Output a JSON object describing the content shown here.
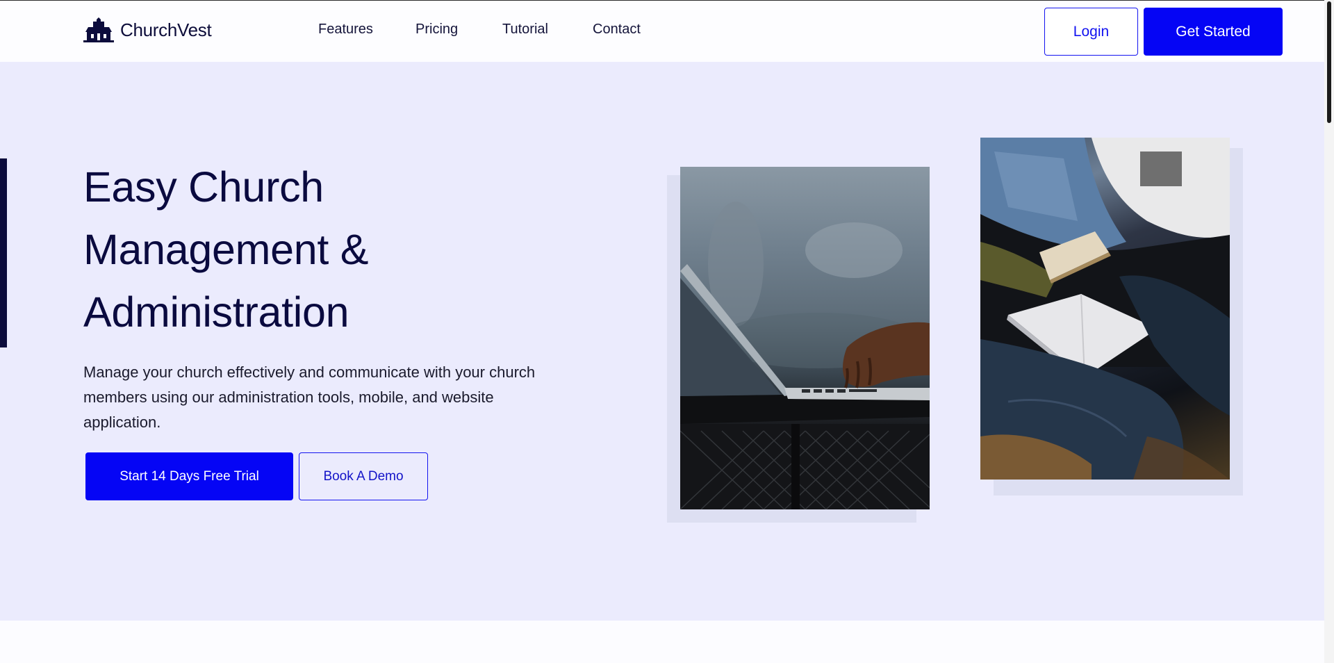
{
  "brand": {
    "name": "ChurchVest",
    "logo_icon": "church-building-icon"
  },
  "nav": {
    "items": [
      "Features",
      "Pricing",
      "Tutorial",
      "Contact"
    ]
  },
  "header": {
    "login_label": "Login",
    "get_started_label": "Get Started"
  },
  "hero": {
    "title_lines": [
      "Easy Church",
      "Management &",
      "Administration"
    ],
    "description": "Manage your church effectively and communicate with your church members using our administration tools, mobile, and website application.",
    "primary_cta": "Start 14 Days Free Trial",
    "secondary_cta": "Book A Demo"
  },
  "images": {
    "photo_left": "laptop-typing-photo",
    "photo_right": "church-members-with-bibles-photo"
  },
  "colors": {
    "accent": "#0505f5",
    "hero_background": "#ebebfd",
    "heading": "#0a0a3f"
  }
}
